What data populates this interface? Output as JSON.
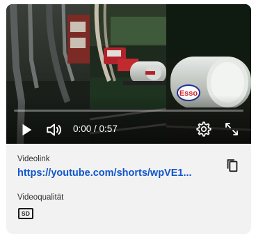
{
  "player": {
    "current_time": "0:00",
    "duration": "0:57",
    "time_separator": " / ",
    "progress": 0.0,
    "thumbnail_logo": "Esso",
    "icons": {
      "play": "play-icon",
      "volume": "volume-icon",
      "settings": "gear-icon",
      "fullscreen": "fullscreen-icon"
    }
  },
  "details": {
    "link_label": "Videolink",
    "link_url": "https://youtube.com/shorts/wpVE1...",
    "quality_label": "Videoqualität",
    "quality_badge": "SD",
    "copy_icon": "copy-icon"
  },
  "colors": {
    "card_background": "#f2f2f2",
    "link": "#1155cc"
  }
}
